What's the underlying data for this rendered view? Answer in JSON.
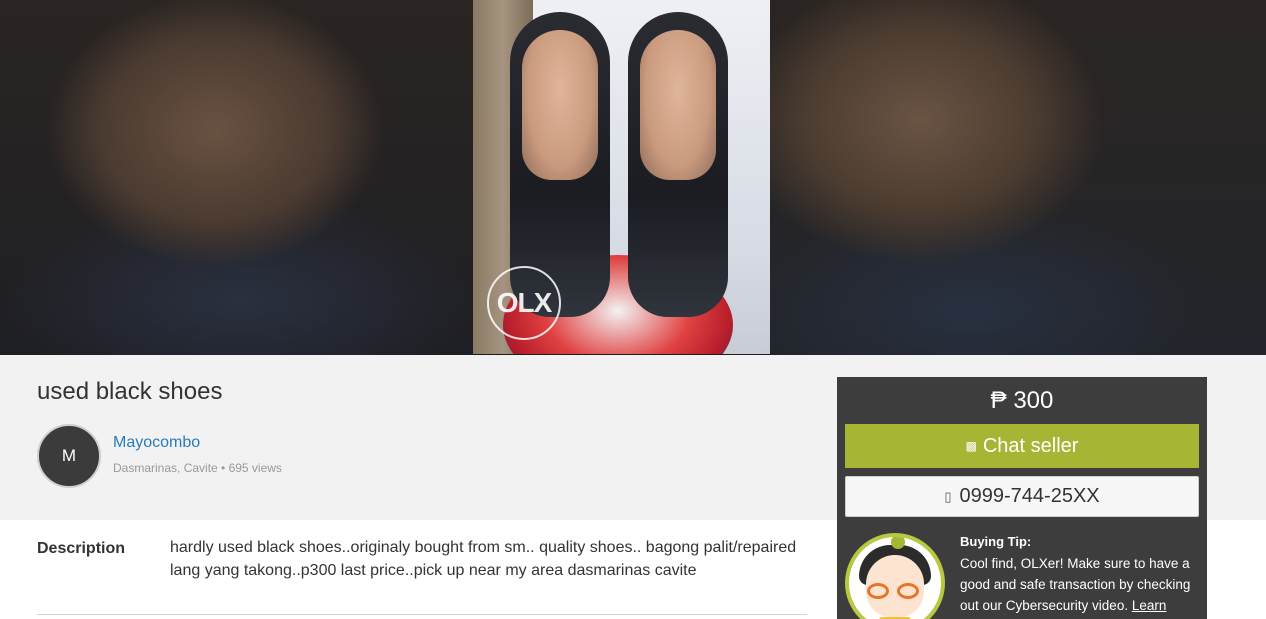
{
  "listing": {
    "title": "used black shoes",
    "watermark": "OLX"
  },
  "seller": {
    "initial": "M",
    "name": "Mayocombo",
    "meta": "Dasmarinas, Cavite • 695 views"
  },
  "description": {
    "label": "Description",
    "text": "hardly used black shoes..originaly bought from sm.. quality shoes.. bagong palit/repaired lang yang takong..p300 last price..pick up near my area dasmarinas cavite"
  },
  "panel": {
    "price": "₱ 300",
    "chat_label": "Chat seller",
    "phone": "0999-744-25XX",
    "tip_title": "Buying Tip:",
    "tip_text": "Cool find, OLXer! Make sure to have a good and safe transaction by checking out our Cybersecurity video.",
    "tip_link": "Learn"
  },
  "colors": {
    "chat_button": "#a6b534",
    "panel_bg": "#3d3d3d",
    "link": "#2a7ab8"
  },
  "icons": {
    "chat": "chat-bubble-icon",
    "phone": "phone-icon"
  }
}
